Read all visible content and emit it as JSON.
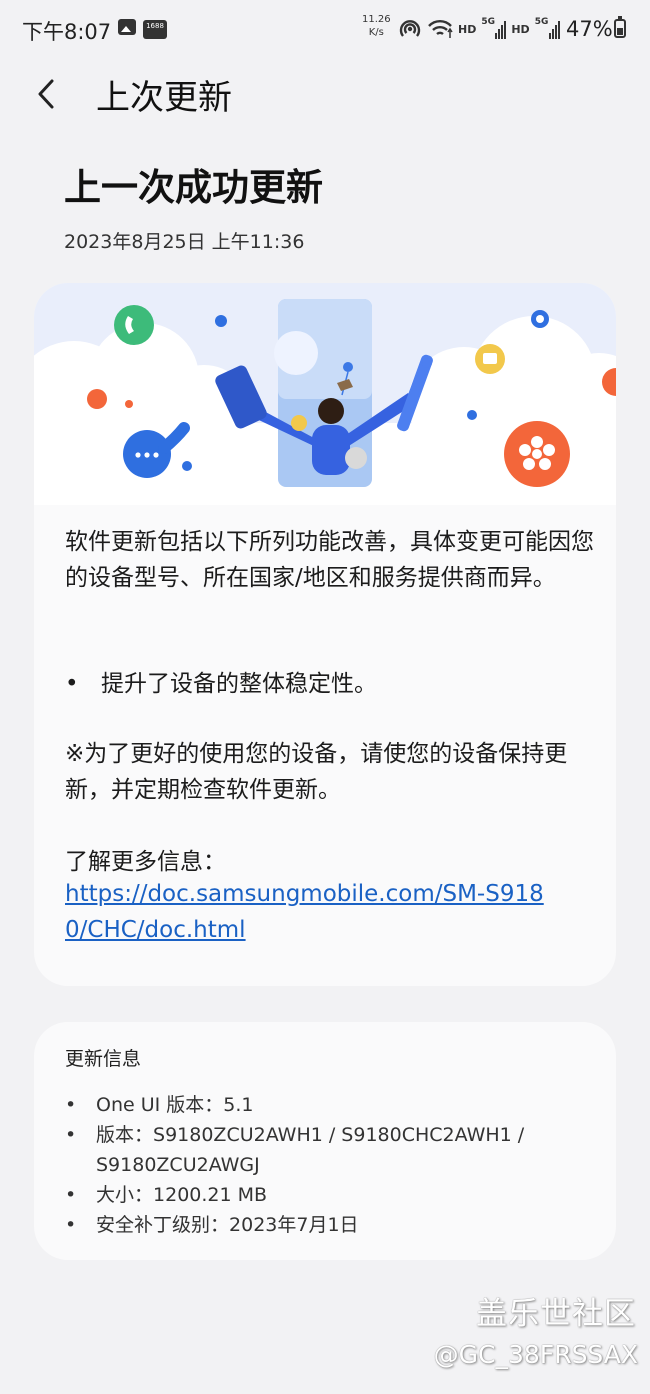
{
  "status_bar": {
    "time": "下午8:07",
    "badge": "1688",
    "speed_value": "11.26",
    "speed_unit": "K/s",
    "hd1": "HD",
    "sig1": "5G",
    "hd2": "HD",
    "sig2": "5G",
    "battery": "47%"
  },
  "header": {
    "title": "上次更新"
  },
  "main": {
    "heading": "上一次成功更新",
    "date": "2023年8月25日 上午11:36",
    "description": "软件更新包括以下所列功能改善，具体变更可能因您的设备型号、所在国家/地区和服务提供商而异。",
    "bullet": "提升了设备的整体稳定性。",
    "notice": "※为了更好的使用您的设备，请使您的设备保持更新，并定期检查软件更新。",
    "more_label": "了解更多信息：",
    "link": "https://doc.samsungmobile.com/SM-S9180/CHC/doc.html"
  },
  "update_info": {
    "title": "更新信息",
    "items": [
      {
        "label": "One UI 版本：",
        "value": "5.1"
      },
      {
        "label": "版本：",
        "value": "S9180ZCU2AWH1 / S9180CHC2AWH1 / S9180ZCU2AWGJ"
      },
      {
        "label": "大小：",
        "value": "1200.21 MB"
      },
      {
        "label": "安全补丁级别：",
        "value": "2023年7月1日"
      }
    ]
  },
  "watermark": {
    "line1": "盖乐世社区",
    "line2": "@GC_38FRSSAX"
  },
  "colors": {
    "background": "#f2f2f4",
    "card": "#fafafb",
    "link": "#1a61c4",
    "accent_orange": "#f3663a",
    "accent_green": "#3dbb7a",
    "accent_blue": "#2f6fe0"
  }
}
